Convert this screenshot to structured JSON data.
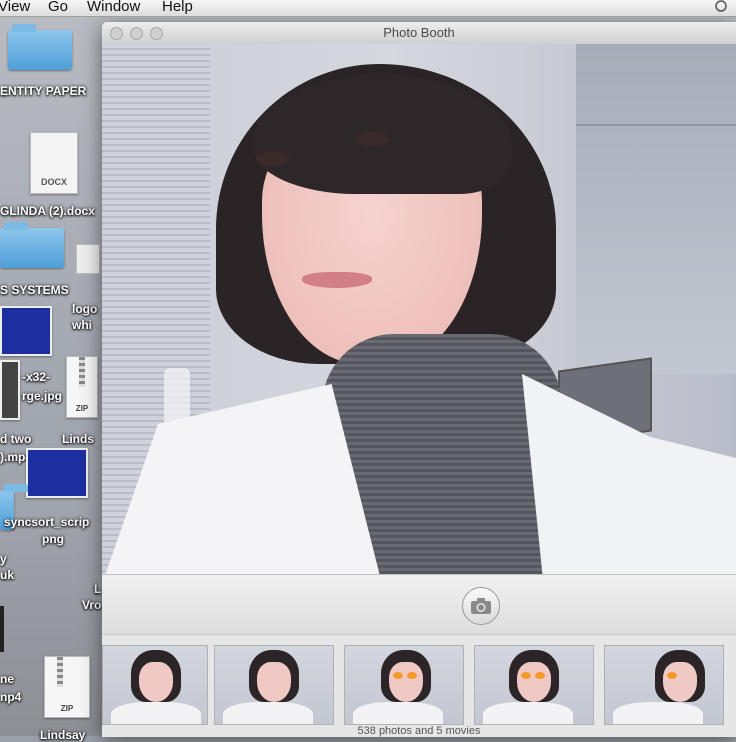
{
  "menubar": {
    "items": [
      "View",
      "Go",
      "Window",
      "Help"
    ]
  },
  "desktop": {
    "icons": [
      {
        "label": "ENTITY PAPER"
      },
      {
        "label": "DOCX"
      },
      {
        "label": "GLINDA (2).docx"
      },
      {
        "label": "S SYSTEMS"
      },
      {
        "label": "logo"
      },
      {
        "label": "whi"
      },
      {
        "label": "-x32-"
      },
      {
        "label": "rge.jpg"
      },
      {
        "label": "ZIP"
      },
      {
        "label": "d two"
      },
      {
        "label": ").mp4"
      },
      {
        "label": "Linds"
      },
      {
        "label": "syncsort_scrip"
      },
      {
        "label": "png"
      },
      {
        "label": "y"
      },
      {
        "label": "uk"
      },
      {
        "label": "L"
      },
      {
        "label": "Vro"
      },
      {
        "label": "ne"
      },
      {
        "label": "np4"
      },
      {
        "label": "ZIP"
      },
      {
        "label": "Lindsay"
      }
    ]
  },
  "window": {
    "title": "Photo Booth",
    "strip_count": "538 photos and 5 movies"
  },
  "colors": {
    "accent_glasses": "#f39a2b",
    "desktop_blue": "#1d2fa0"
  }
}
